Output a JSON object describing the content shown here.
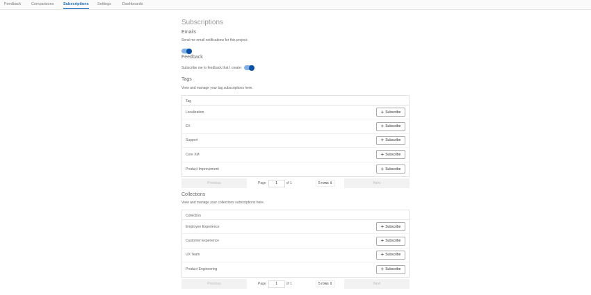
{
  "nav": {
    "tabs": [
      "Feedback",
      "Comparisons",
      "Subscriptions",
      "Settings",
      "Dashboards"
    ],
    "active": "Subscriptions"
  },
  "title": "Subscriptions",
  "emails": {
    "heading": "Emails",
    "label": "Send me email notifications for this project:",
    "enabled": true
  },
  "feedback": {
    "heading": "Feedback",
    "label": "Subscribe me to feedback that I create:",
    "enabled": true
  },
  "tags": {
    "heading": "Tags",
    "description": "View and manage your tag subscriptions here.",
    "column": "Tag",
    "rows": [
      "Localization",
      "EX",
      "Support",
      "Core XM",
      "Product Improvement"
    ]
  },
  "collections": {
    "heading": "Collections",
    "description": "View and manage your collections subscriptions here.",
    "column": "Collection",
    "rows": [
      "Employee Experience",
      "Customer Experience",
      "UX Team",
      "Product Engineering"
    ]
  },
  "subscribe_label": "Subscribe",
  "pagination": {
    "previous": "Previous",
    "next": "Next",
    "page_label": "Page",
    "page": "1",
    "of": "of 1",
    "rows": "5 rows"
  },
  "colors": {
    "accent": "#1a6bb8",
    "toggle_knob": "#0b4fa3",
    "toggle_track": "#7fb0e6"
  }
}
